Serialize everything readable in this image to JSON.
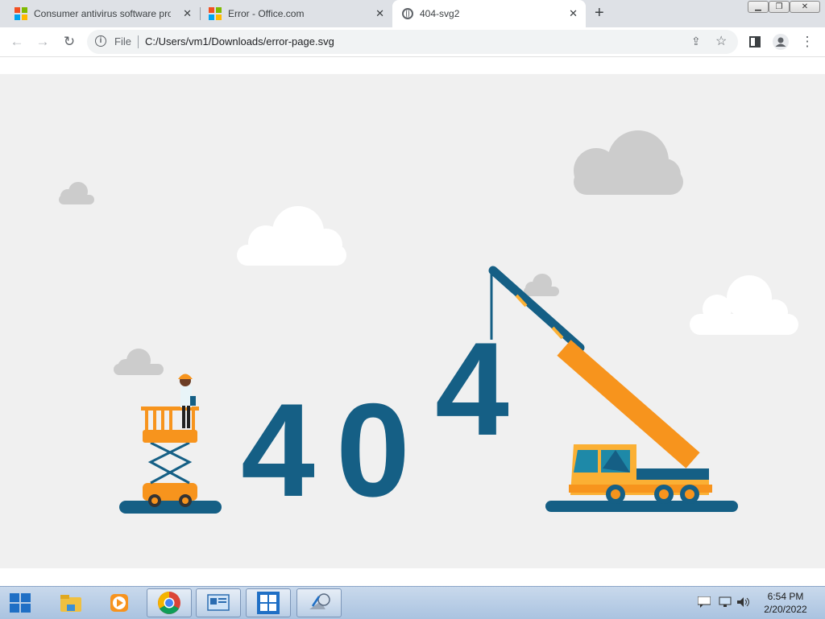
{
  "browser": {
    "tabs": [
      {
        "title": "Consumer antivirus software pro",
        "icon": "microsoft-logo-icon",
        "active": false
      },
      {
        "title": "Error - Office.com",
        "icon": "microsoft-logo-icon",
        "active": false
      },
      {
        "title": "404-svg2",
        "icon": "globe-icon",
        "active": true
      }
    ],
    "new_tab": "+",
    "close": "✕",
    "address": {
      "scheme_label": "File",
      "url": "C:/Users/vm1/Downloads/error-page.svg"
    }
  },
  "page": {
    "digits": [
      "4",
      "0",
      "4"
    ],
    "colors": {
      "background": "#f0f0f0",
      "digit": "#155f85",
      "orange": "#f7941d",
      "yellow": "#fbb034",
      "cloud_gray": "#cccccc",
      "cloud_white": "#ffffff"
    }
  },
  "taskbar": {
    "items": [
      "start-button",
      "file-explorer-icon",
      "media-player-icon",
      "chrome-icon",
      "control-panel-icon",
      "windows-store-icon",
      "network-tool-icon"
    ],
    "clock": {
      "time": "6:54 PM",
      "date": "2/20/2022"
    }
  }
}
